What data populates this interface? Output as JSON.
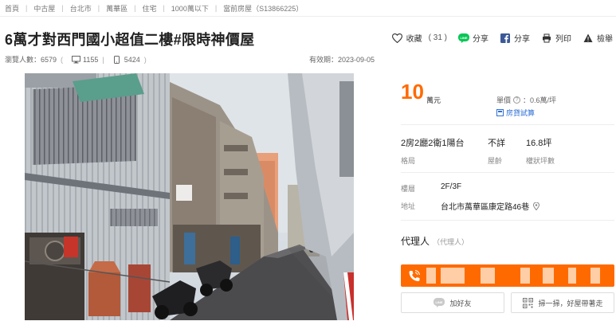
{
  "breadcrumb": [
    "首頁",
    "中古屋",
    "台北市",
    "萬華區",
    "住宅",
    "1000萬以下",
    "當前房屋（S13866225）"
  ],
  "title": "6萬才對西門國小超值二樓#限時神價屋",
  "actions": {
    "favorite_label": "收藏",
    "favorite_count": "( 31 )",
    "line_share_label": "分享",
    "fb_share_label": "分享",
    "print_label": "列印",
    "report_label": "檢舉"
  },
  "stats": {
    "views_label": "瀏覽人數：",
    "views_total": "6579",
    "desktop_views": "1155",
    "mobile_views": "5424",
    "valid_until": "有效期：2023-09-05"
  },
  "price": {
    "value": "10",
    "unit": "萬元",
    "unit_price_label": "單價",
    "unit_price_value": "：0.6萬/坪",
    "loan_calc_label": "房貸試算"
  },
  "specs": [
    {
      "value": "2房2廳2衛1陽台",
      "label": "格局"
    },
    {
      "value": "不詳",
      "label": "屋齡"
    },
    {
      "value": "16.8坪",
      "label": "權狀坪數"
    }
  ],
  "details": {
    "floor_label": "樓層",
    "floor_value": "2F/3F",
    "address_label": "地址",
    "address_value": "台北市萬華區康定路46巷"
  },
  "agent": {
    "title": "代理人",
    "role": "（代理人）"
  },
  "buttons": {
    "add_friend": "加好友",
    "scan_label": "掃一掃，好屋帶著走"
  },
  "colors": {
    "accent": "#ff6a00",
    "link": "#2f6fd6",
    "line_green": "#06c755",
    "fb_blue": "#3b5998"
  }
}
